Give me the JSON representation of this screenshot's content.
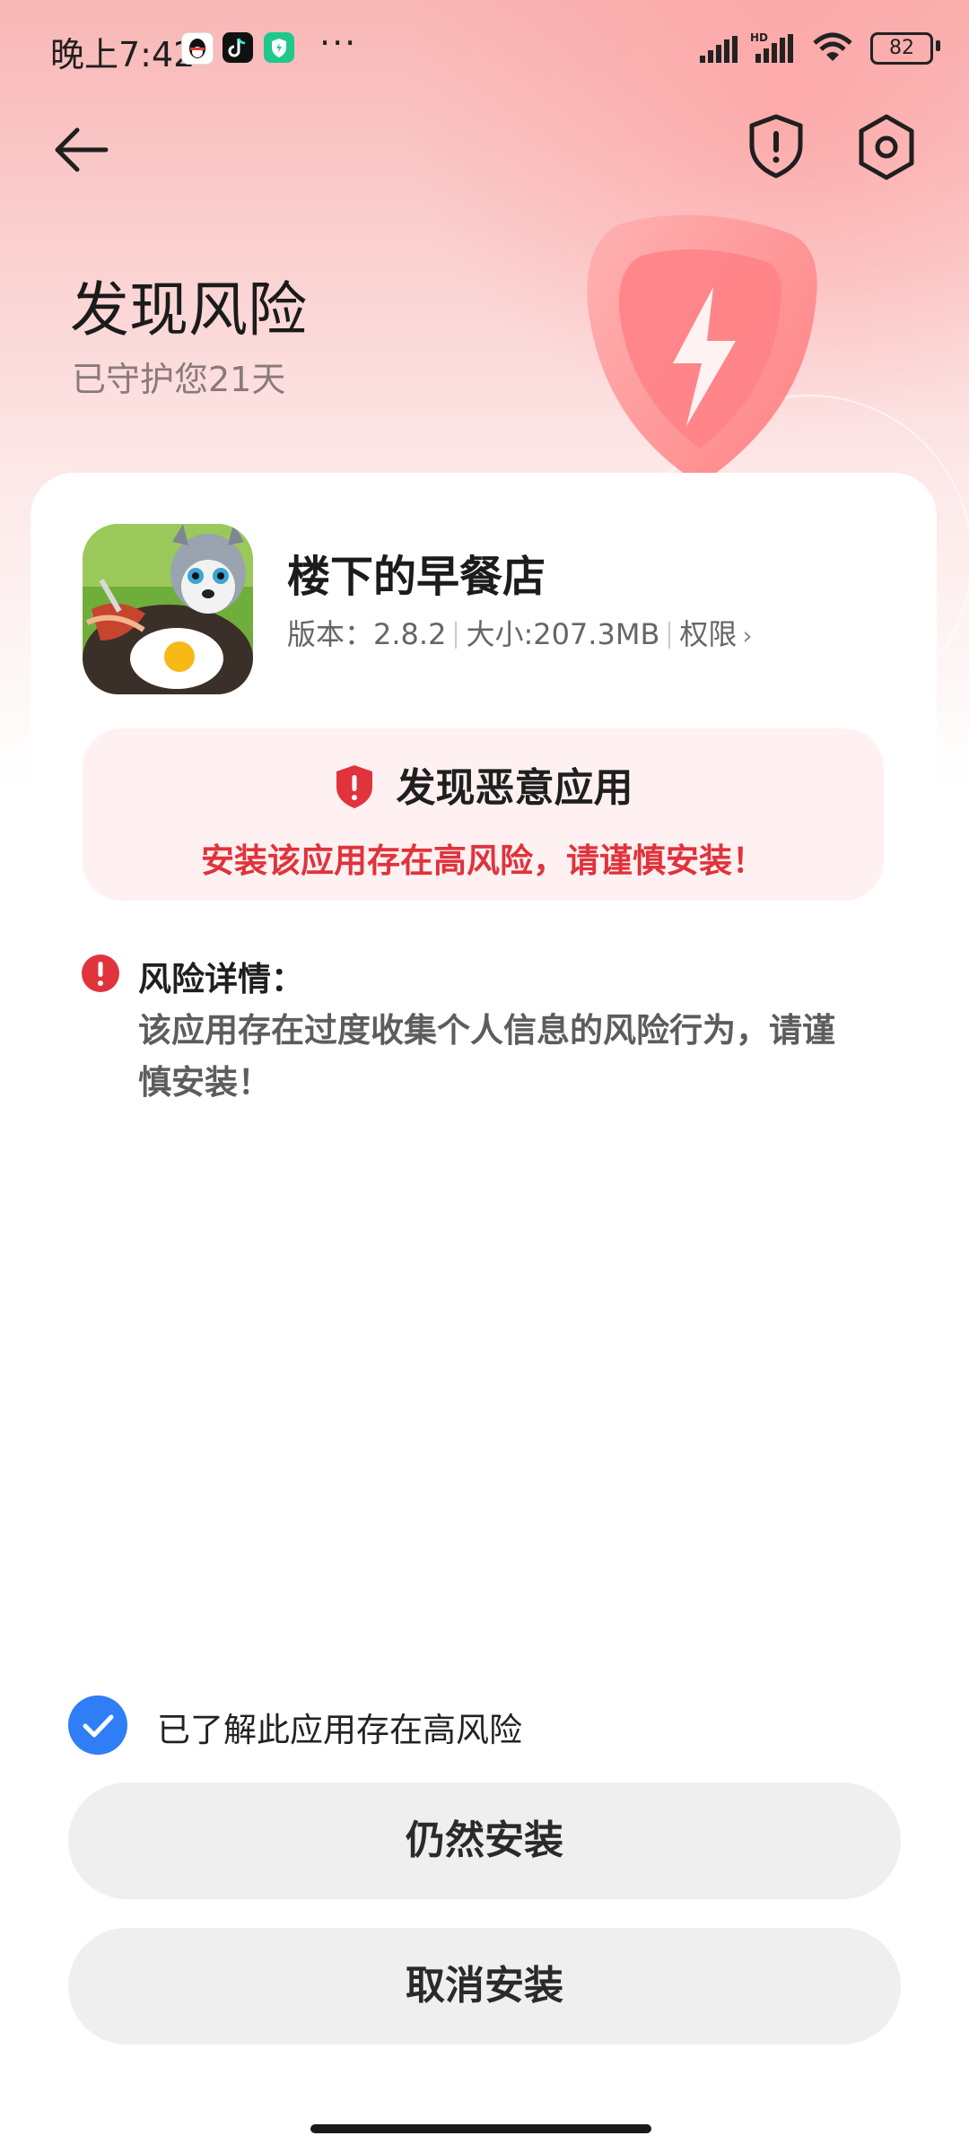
{
  "status_bar": {
    "time": "晚上7:42",
    "more": "···",
    "battery": "82",
    "icons": [
      "qq-icon",
      "tiktok-icon",
      "security-app-icon",
      "signal-icon",
      "hd-signal-icon",
      "wifi-icon",
      "battery-icon"
    ]
  },
  "header": {
    "title": "发现风险",
    "subtitle": "已守护您21天",
    "icons": [
      "back-arrow-icon",
      "shield-alert-icon",
      "settings-icon"
    ]
  },
  "app": {
    "name": "楼下的早餐店",
    "version": "版本：2.8.2",
    "size": "大小:207.3MB",
    "permissions": "权限",
    "chevron": "›"
  },
  "alert": {
    "title": "发现恶意应用",
    "description": "安装该应用存在高风险，请谨慎安装！",
    "accent_color": "#e0333c"
  },
  "risk": {
    "label": "风险详情：",
    "text": "该应用存在过度收集个人信息的风险行为，请谨慎安装！"
  },
  "acknowledge": {
    "label": "已了解此应用存在高风险",
    "checked": true,
    "check_color": "#2f7ef6"
  },
  "buttons": {
    "install_anyway": "仍然安装",
    "cancel_install": "取消安装"
  }
}
